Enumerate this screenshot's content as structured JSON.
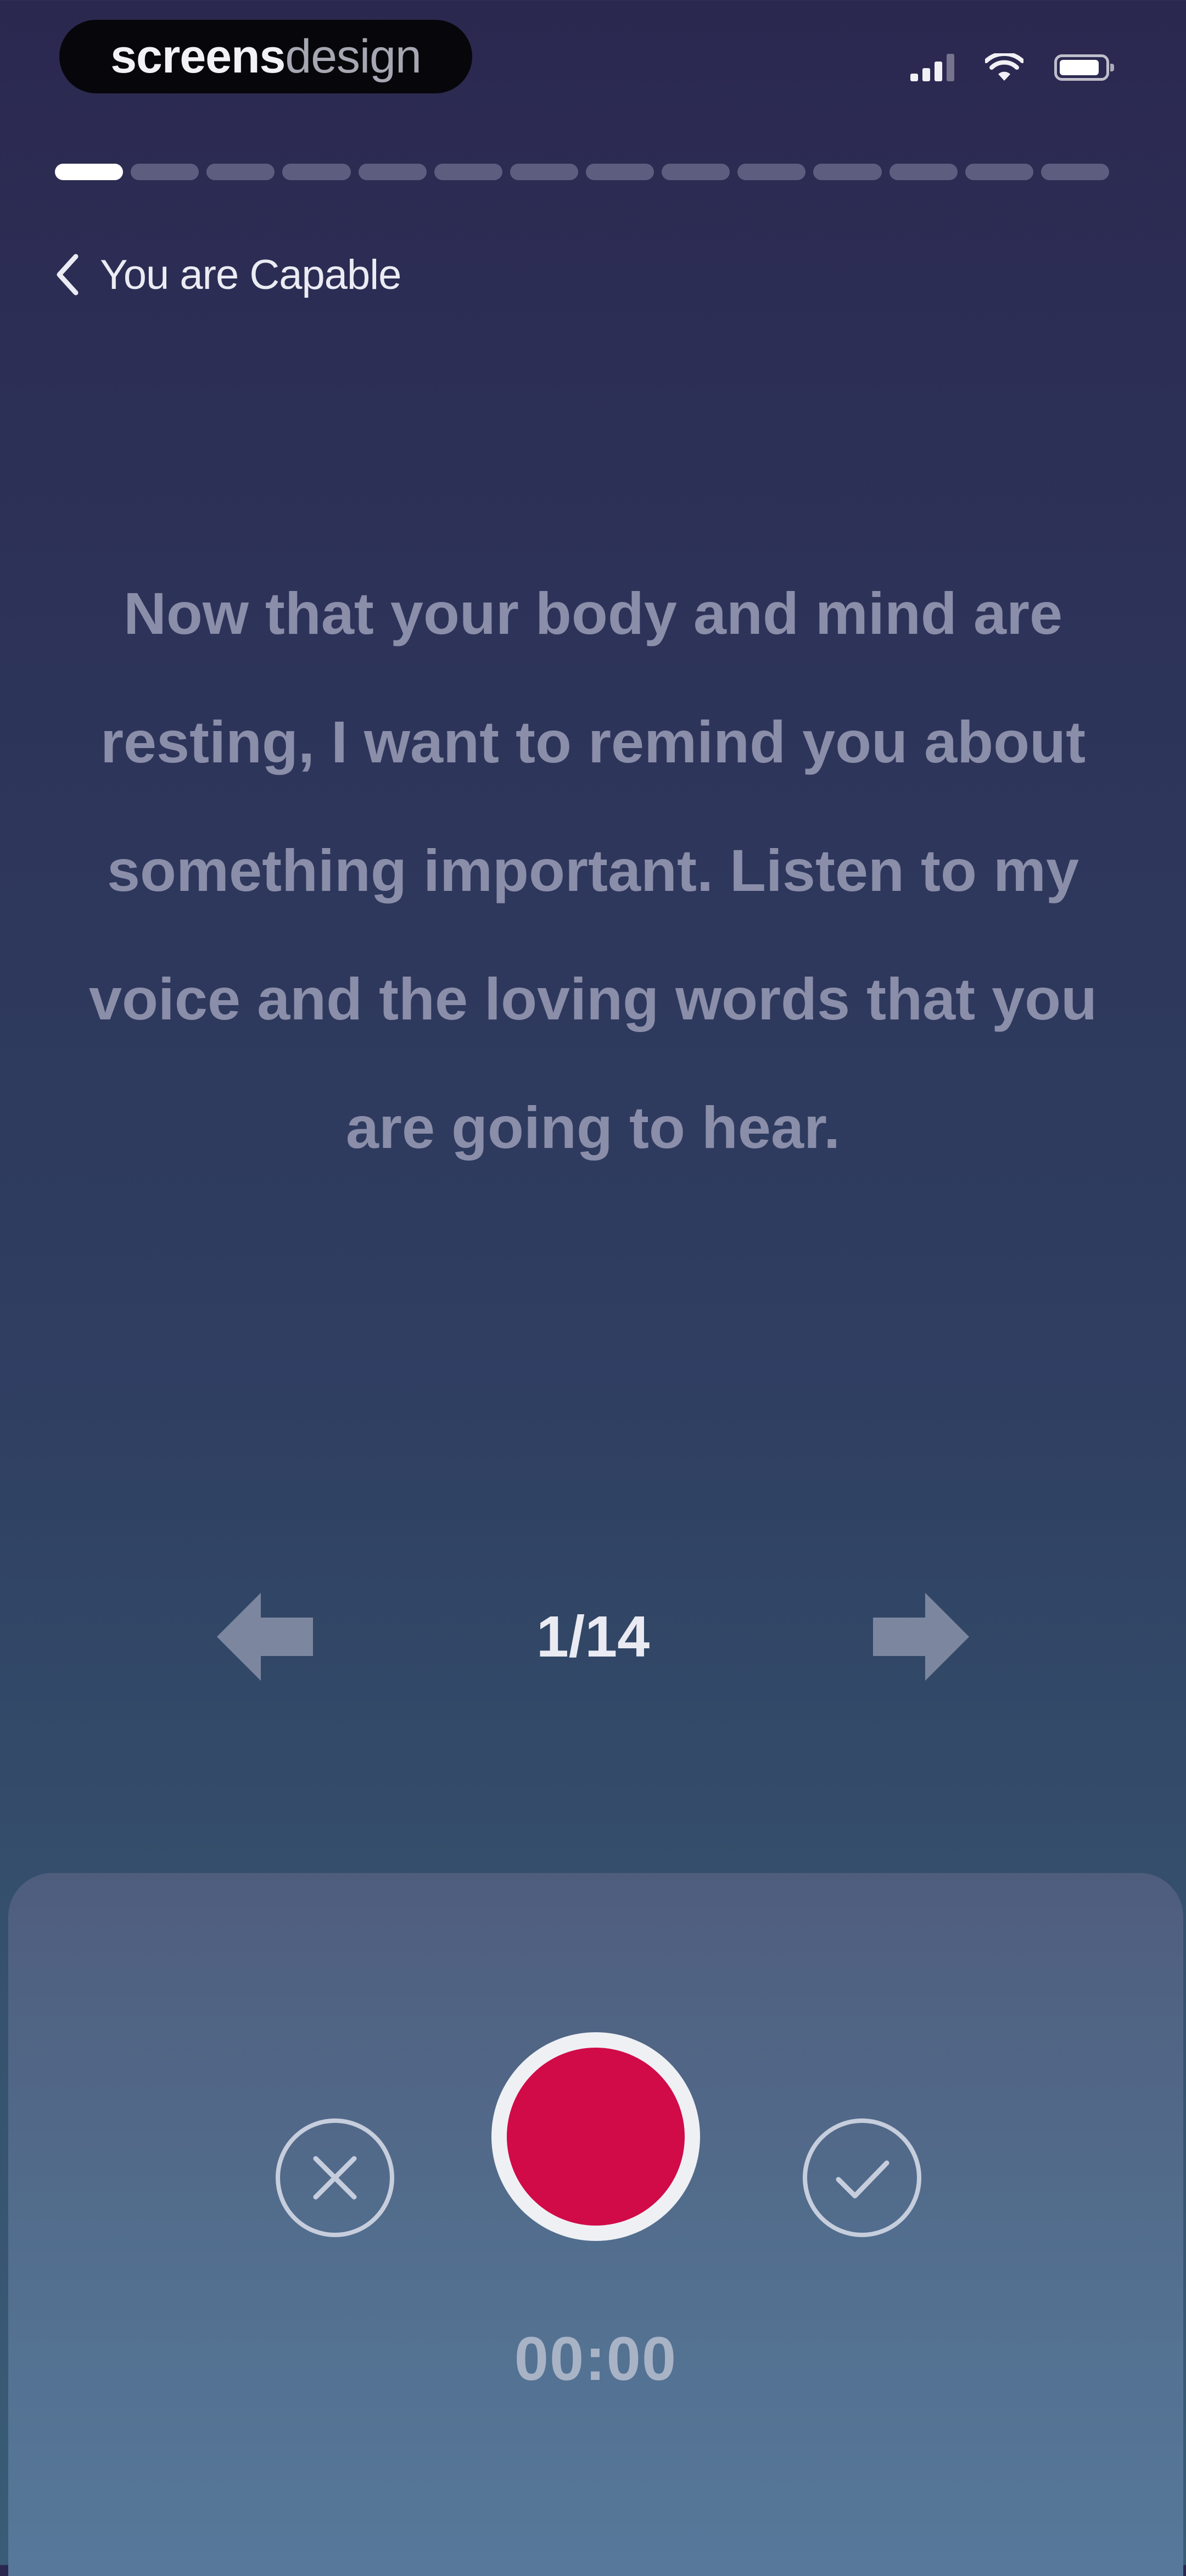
{
  "status_bar": {
    "brand_bold": "screens",
    "brand_light": "design",
    "icons": [
      "signal-icon",
      "wifi-icon",
      "battery-icon"
    ]
  },
  "progress": {
    "total_segments": 14,
    "current_segment": 1
  },
  "nav": {
    "back_label": "You are Capable"
  },
  "script": {
    "text": "Now that your body and mind are resting, I want to remind you about something important. Listen to my voice and the loving words that you are going to hear."
  },
  "pager": {
    "counter": "1/14",
    "prev_icon": "arrow-left-icon",
    "next_icon": "arrow-right-icon"
  },
  "recorder": {
    "timer": "00:00",
    "discard_icon": "close-circle-icon",
    "confirm_icon": "check-circle-icon"
  },
  "colors": {
    "record": "#d10a48",
    "background_top": "#2b2850",
    "background_bottom": "#3a5c77",
    "panel": "#537090"
  }
}
